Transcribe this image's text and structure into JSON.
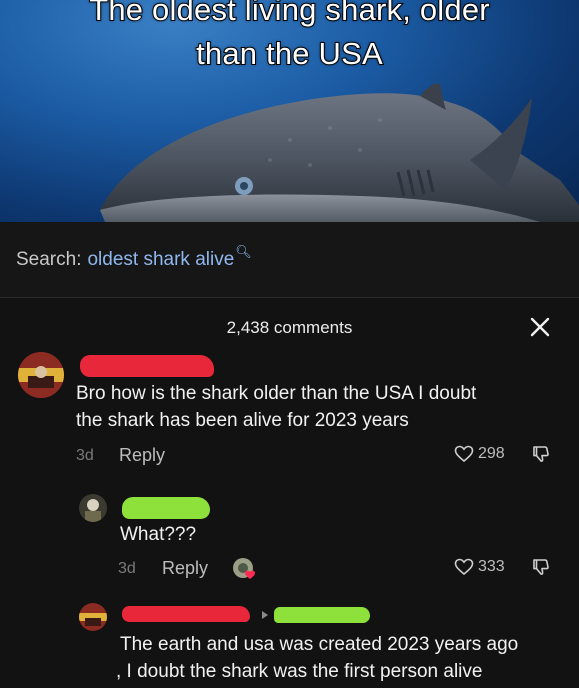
{
  "video": {
    "caption_line1": "The oldest living shark, older",
    "caption_line2": "than the USA"
  },
  "search": {
    "prefix": "Search:",
    "term": "oldest shark alive"
  },
  "comments_panel": {
    "count_label": "2,438 comments",
    "comments": [
      {
        "text_line1": "Bro how is the shark older than the USA I doubt",
        "text_line2": "the shark has been alive for 2023 years",
        "age": "3d",
        "reply_label": "Reply",
        "likes": "298"
      },
      {
        "text_line1": "What???",
        "age": "3d",
        "reply_label": "Reply",
        "likes": "333"
      },
      {
        "text_line1": "The earth and usa was created 2023 years ago",
        "text_line2": ", I doubt the shark was the first person alive"
      }
    ]
  },
  "colors": {
    "background": "#121212",
    "search_term": "#8fb7ee",
    "redaction_red": "#e8283a",
    "redaction_green": "#8ee03a"
  }
}
